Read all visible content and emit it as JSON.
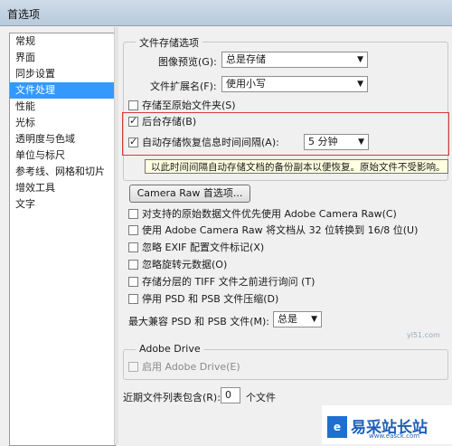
{
  "window": {
    "title": "首选项"
  },
  "sidebar": {
    "items": [
      {
        "label": "常规"
      },
      {
        "label": "界面"
      },
      {
        "label": "同步设置"
      },
      {
        "label": "文件处理"
      },
      {
        "label": "性能"
      },
      {
        "label": "光标"
      },
      {
        "label": "透明度与色域"
      },
      {
        "label": "单位与标尺"
      },
      {
        "label": "参考线、网格和切片"
      },
      {
        "label": "增效工具"
      },
      {
        "label": "文字"
      }
    ],
    "selected_index": 3
  },
  "file_save": {
    "group_title": "文件存储选项",
    "image_preview": {
      "label": "图像预览(G):",
      "value": "总是存储"
    },
    "file_extension": {
      "label": "文件扩展名(F):",
      "value": "使用小写"
    },
    "save_to_original": {
      "label": "存储至原始文件夹(S)",
      "checked": false
    },
    "background_save": {
      "label": "后台存储(B)",
      "checked": true
    },
    "autosave": {
      "label": "自动存储恢复信息时间间隔(A):",
      "checked": true,
      "interval": "5 分钟"
    }
  },
  "tooltip": "以此时间间隔自动存储文档的备份副本以便恢复。原始文件不受影响。",
  "compat": {
    "camera_raw_button": "Camera Raw 首选项...",
    "options": [
      {
        "label": "对支持的原始数据文件优先使用 Adobe Camera Raw(C)",
        "checked": false
      },
      {
        "label": "使用 Adobe Camera Raw 将文档从 32 位转换到 16/8 位(U)",
        "checked": false
      },
      {
        "label": "忽略 EXIF 配置文件标记(X)",
        "checked": false
      },
      {
        "label": "忽略旋转元数据(O)",
        "checked": false
      },
      {
        "label": "存储分层的 TIFF 文件之前进行询问 (T)",
        "checked": false
      },
      {
        "label": "停用 PSD 和 PSB 文件压缩(D)",
        "checked": false
      }
    ],
    "max_compat": {
      "label": "最大兼容 PSD 和 PSB 文件(M):",
      "value": "总是"
    }
  },
  "adobe_drive": {
    "group_title": "Adobe Drive",
    "enable": {
      "label": "启用 Adobe Drive(E)",
      "checked": false,
      "enabled": false
    }
  },
  "recent_files": {
    "label_before": "近期文件列表包含(R):",
    "value": "0",
    "label_after": "个文件"
  },
  "watermark": {
    "name": "易采站长站",
    "url": "www.easck.com",
    "logo_glyph": "e",
    "faint": "yl51.com"
  },
  "colors": {
    "selection": "#3399ff",
    "highlight_border": "#d83b3b",
    "tooltip_bg": "#ffffe1"
  }
}
